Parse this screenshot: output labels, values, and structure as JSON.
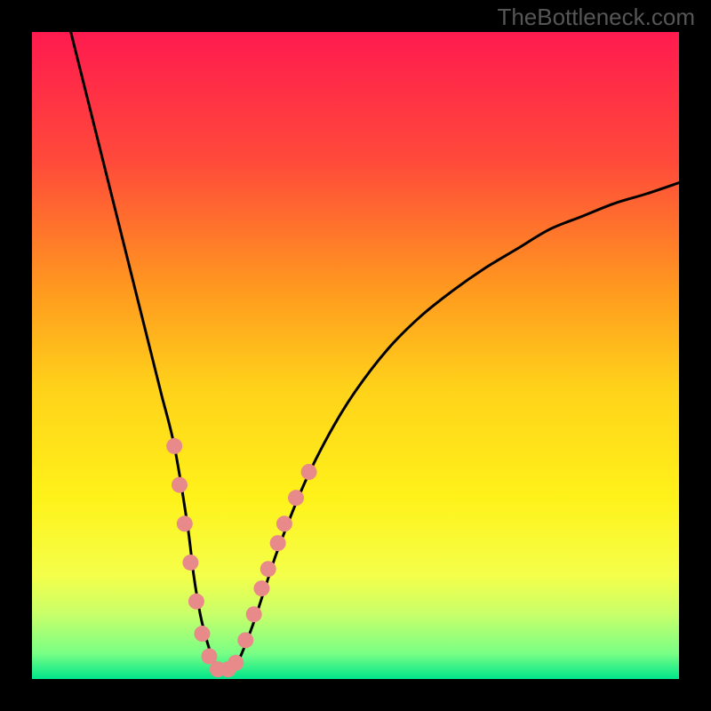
{
  "watermark": "TheBottleneck.com",
  "chart_data": {
    "type": "line",
    "title": "",
    "xlabel": "",
    "ylabel": "",
    "xlim": [
      0,
      100
    ],
    "ylim": [
      0,
      100
    ],
    "background": {
      "type": "vertical-gradient",
      "stops": [
        {
          "offset": 0.0,
          "color": "#ff1a4f"
        },
        {
          "offset": 0.2,
          "color": "#ff4a3a"
        },
        {
          "offset": 0.4,
          "color": "#ff9a1f"
        },
        {
          "offset": 0.55,
          "color": "#ffd21a"
        },
        {
          "offset": 0.72,
          "color": "#fff21a"
        },
        {
          "offset": 0.84,
          "color": "#f4ff4a"
        },
        {
          "offset": 0.9,
          "color": "#c8ff6a"
        },
        {
          "offset": 0.96,
          "color": "#7aff85"
        },
        {
          "offset": 1.0,
          "color": "#00e58a"
        }
      ]
    },
    "series": [
      {
        "name": "bottleneck-curve",
        "color": "#000000",
        "x": [
          6.0,
          8.0,
          10.0,
          12.0,
          14.0,
          16.0,
          18.0,
          20.0,
          22.0,
          24.0,
          25.0,
          26.0,
          27.0,
          28.0,
          29.0,
          30.0,
          31.0,
          32.0,
          34.0,
          36.0,
          38.0,
          42.0,
          46.0,
          50.0,
          55.0,
          60.0,
          65.0,
          70.0,
          75.0,
          80.0,
          85.0,
          90.0,
          95.0,
          100.0
        ],
        "values": [
          100.0,
          92.0,
          84.0,
          76.0,
          68.0,
          60.0,
          52.0,
          44.0,
          36.0,
          24.0,
          16.0,
          10.0,
          6.0,
          3.0,
          1.5,
          1.0,
          1.5,
          3.0,
          8.0,
          14.0,
          20.0,
          30.0,
          38.0,
          44.5,
          51.0,
          56.0,
          60.0,
          63.5,
          66.5,
          69.5,
          71.5,
          73.5,
          75.0,
          76.7
        ]
      }
    ],
    "markers": {
      "name": "highlighted-points",
      "color": "#e88a8a",
      "radius": 9,
      "points": [
        {
          "x": 22.0,
          "y": 36.0
        },
        {
          "x": 22.8,
          "y": 30.0
        },
        {
          "x": 23.6,
          "y": 24.0
        },
        {
          "x": 24.5,
          "y": 18.0
        },
        {
          "x": 25.4,
          "y": 12.0
        },
        {
          "x": 26.3,
          "y": 7.0
        },
        {
          "x": 27.4,
          "y": 3.5
        },
        {
          "x": 28.7,
          "y": 1.5
        },
        {
          "x": 30.3,
          "y": 1.5
        },
        {
          "x": 31.5,
          "y": 2.5
        },
        {
          "x": 33.0,
          "y": 6.0
        },
        {
          "x": 34.3,
          "y": 10.0
        },
        {
          "x": 35.5,
          "y": 14.0
        },
        {
          "x": 36.5,
          "y": 17.0
        },
        {
          "x": 38.0,
          "y": 21.0
        },
        {
          "x": 39.0,
          "y": 24.0
        },
        {
          "x": 40.8,
          "y": 28.0
        },
        {
          "x": 42.8,
          "y": 32.0
        }
      ]
    },
    "frame": {
      "color": "#000000",
      "width": 36
    }
  }
}
